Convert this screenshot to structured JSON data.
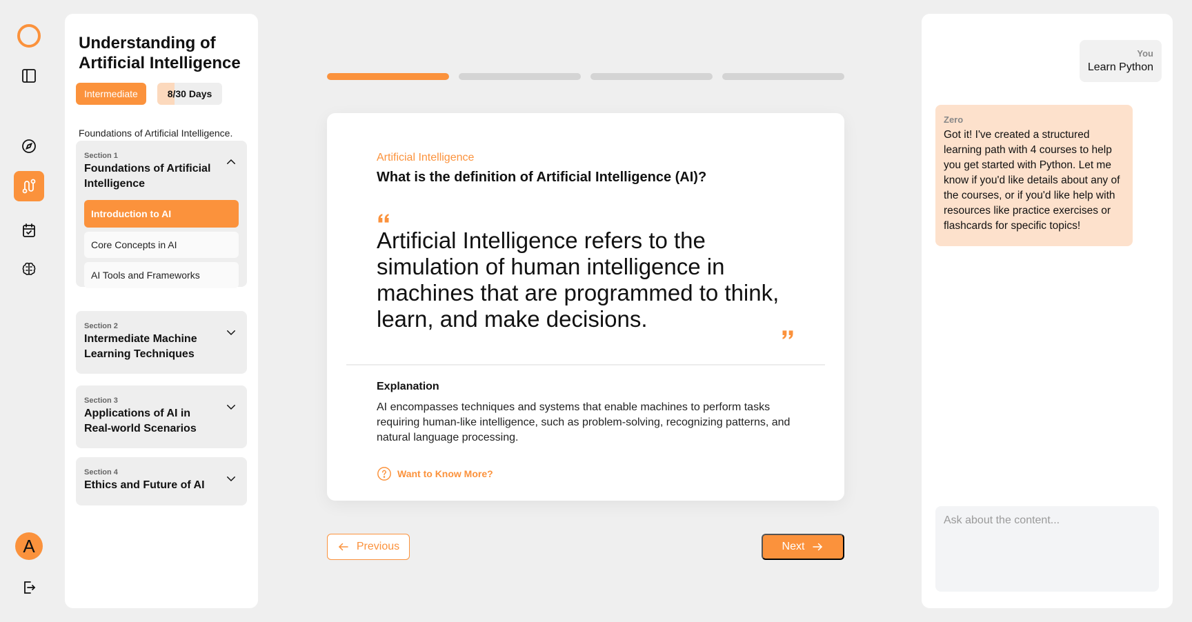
{
  "rail": {
    "items": [
      {
        "icon": "logo-ring-icon"
      },
      {
        "icon": "sidebar-toggle-icon"
      },
      {
        "icon": "compass-icon"
      },
      {
        "icon": "route-icon",
        "active": true
      },
      {
        "icon": "calendar-check-icon"
      },
      {
        "icon": "brain-icon"
      }
    ],
    "avatar_letter": "A",
    "logout_icon": "logout-icon"
  },
  "course": {
    "title": "Understanding of Artificial Intelligence",
    "level": "Intermediate",
    "days_label": "8/30 Days",
    "days_progress": 0.267,
    "subtitle": "Foundations of Artificial Intelligence.",
    "sections": [
      {
        "num": "Section 1",
        "title": "Foundations of Artificial Intelligence",
        "expanded": true,
        "lessons": [
          {
            "label": "Introduction to AI",
            "active": true
          },
          {
            "label": "Core Concepts in AI",
            "active": false
          },
          {
            "label": "AI Tools and Frameworks",
            "active": false
          }
        ]
      },
      {
        "num": "Section 2",
        "title": "Intermediate Machine Learning Techniques",
        "expanded": false
      },
      {
        "num": "Section 3",
        "title": "Applications of AI in Real-world Scenarios",
        "expanded": false
      },
      {
        "num": "Section 4",
        "title": "Ethics and Future of AI",
        "expanded": false
      }
    ]
  },
  "progress": {
    "segments": 4,
    "current": 1
  },
  "card": {
    "category": "Artificial Intelligence",
    "question": "What is the definition of Artificial Intelligence (AI)?",
    "quote": "Artificial Intelligence refers to the simulation of human intelligence in machines that are programmed to think, learn, and make decisions.",
    "explanation_heading": "Explanation",
    "explanation": "AI encompasses techniques and systems that enable machines to perform tasks requiring human-like intelligence, such as problem-solving, recognizing patterns, and natural language processing.",
    "know_more": "Want to Know More?"
  },
  "nav": {
    "previous": "Previous",
    "next": "Next"
  },
  "chat": {
    "messages": [
      {
        "who": "You",
        "text": "Learn Python"
      },
      {
        "who": "Zero",
        "text": "Got it! I've created a structured learning path with 4 courses to help you get started with Python. Let me know if you'd like details about any of the courses, or if you'd like help with resources like practice exercises or flashcards for specific topics!"
      }
    ],
    "input_placeholder": "Ask about the content..."
  },
  "colors": {
    "accent": "#fb923c",
    "accent_light": "#fde1cc",
    "panel": "#ffffff",
    "background": "#efefef"
  }
}
